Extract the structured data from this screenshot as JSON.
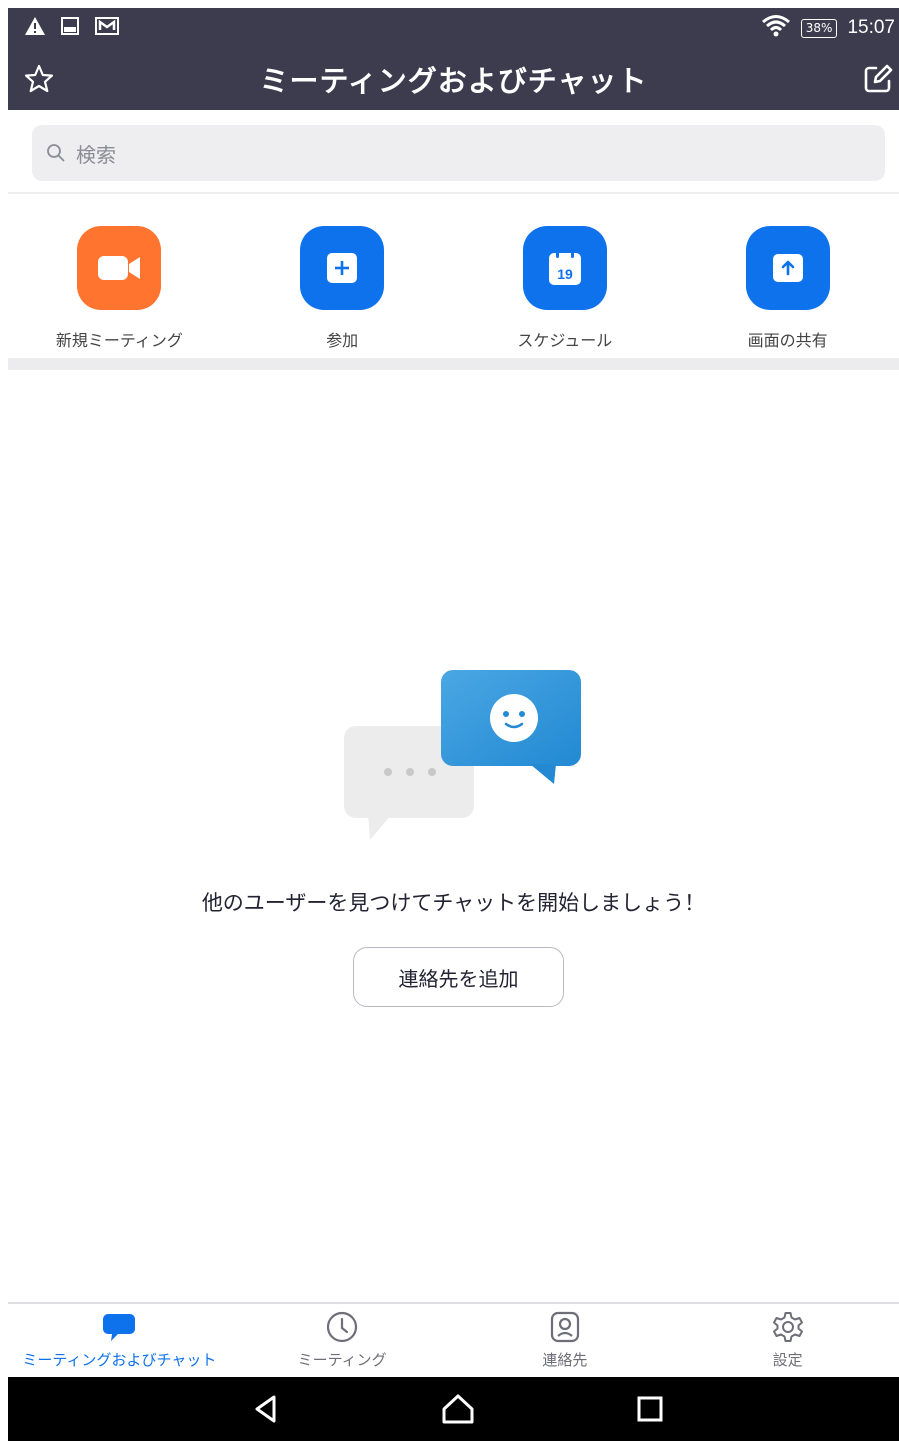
{
  "status_bar": {
    "time": "15:07",
    "battery": "38%"
  },
  "header": {
    "title": "ミーティングおよびチャット"
  },
  "search": {
    "placeholder": "検索"
  },
  "actions": [
    {
      "label": "新規ミーティング",
      "color": "#ff742e",
      "icon": "video-camera-icon"
    },
    {
      "label": "参加",
      "color": "#0e72ed",
      "icon": "plus-icon"
    },
    {
      "label": "スケジュール",
      "color": "#0e72ed",
      "icon": "calendar-icon",
      "calendar_day": "19"
    },
    {
      "label": "画面の共有",
      "color": "#0e72ed",
      "icon": "share-screen-icon"
    }
  ],
  "empty_state": {
    "message": "他のユーザーを見つけてチャットを開始しましょう！",
    "button_label": "連絡先を追加"
  },
  "tabs": [
    {
      "label": "ミーティングおよびチャット",
      "icon": "chat-bubble-icon",
      "active": true
    },
    {
      "label": "ミーティング",
      "icon": "clock-icon",
      "active": false
    },
    {
      "label": "連絡先",
      "icon": "contact-icon",
      "active": false
    },
    {
      "label": "設定",
      "icon": "gear-icon",
      "active": false
    }
  ],
  "colors": {
    "accent": "#0e72ed",
    "header_bg": "#3c3c4e",
    "new_meeting": "#ff742e"
  }
}
